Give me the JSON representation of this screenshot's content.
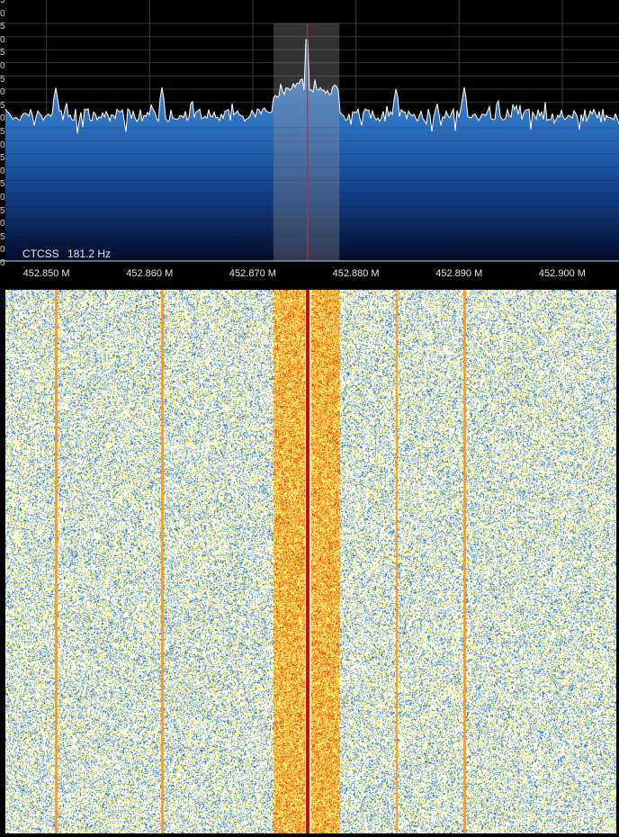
{
  "spectrum": {
    "db_scale_labels": [
      "5",
      "0",
      "5",
      "0",
      "5",
      "0",
      "5",
      "0",
      "5",
      "0",
      "5",
      "0",
      "5",
      "0",
      "5",
      "0",
      "5",
      "0",
      "5",
      "0",
      "0"
    ],
    "frequency_labels": [
      "452.850 M",
      "452.860 M",
      "452.870 M",
      "452.880 M",
      "452.890 M",
      "452.900 M"
    ],
    "frequency_axis_mhz": [
      452.85,
      452.86,
      452.87,
      452.88,
      452.89,
      452.9
    ],
    "visible_span_mhz": [
      452.8455,
      452.9055
    ],
    "tuned_frequency_mhz": 452.8753,
    "filter_passband_mhz": [
      452.872,
      452.8784
    ],
    "ctcss": {
      "label": "CTCSS",
      "value": "181.2 Hz"
    },
    "colors": {
      "fill_top": "#4f93d8",
      "fill_bottom": "#020b2a",
      "trace": "#ffffff",
      "tuning_line": "#e0201a",
      "passband": "#9a9a9a",
      "grid": "#3a3a3a"
    }
  },
  "waterfall": {
    "carrier_lines_mhz": [
      452.8509,
      452.8612,
      452.8753,
      452.8839,
      452.8905
    ],
    "signal_band_mhz": [
      452.872,
      452.8784
    ],
    "colors": [
      "#ffffff",
      "#f7f77a",
      "#3d86d6",
      "#ff9a1c",
      "#e03010",
      "#b01010"
    ]
  }
}
